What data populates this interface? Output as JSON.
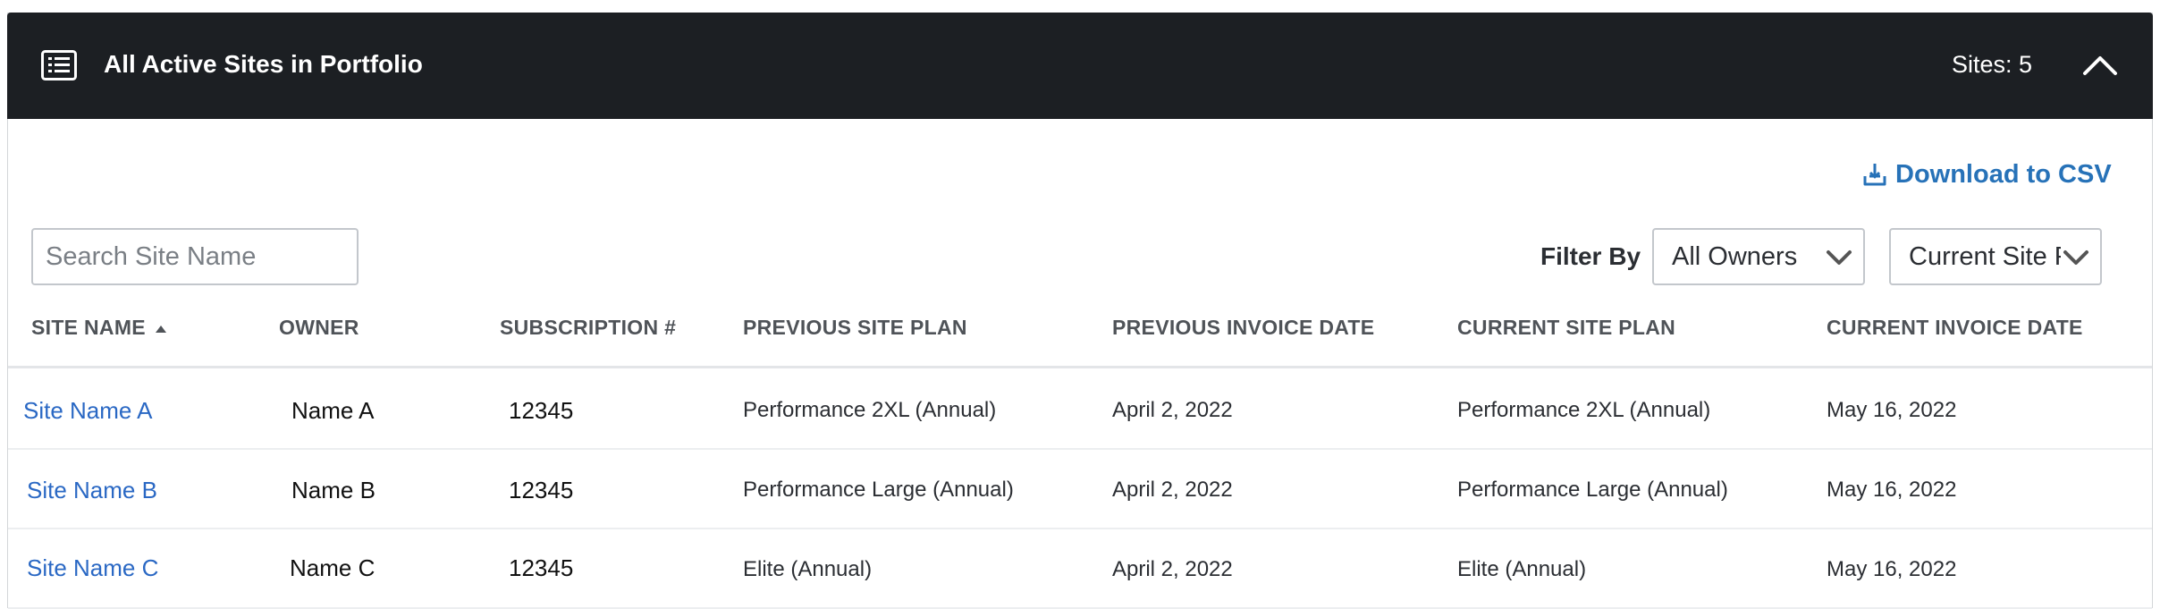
{
  "header": {
    "title": "All Active Sites in Portfolio",
    "sites_count": "Sites: 5",
    "icon": "list-icon",
    "background": "#1c1f23"
  },
  "toolbar": {
    "download_label": "Download to CSV",
    "search_placeholder": "Search Site Name",
    "filter_label": "Filter By",
    "owners_select": "All Owners",
    "plan_select": "Current Site P",
    "accent_color": "#2772b8"
  },
  "table": {
    "columns": [
      "SITE NAME",
      "OWNER",
      "SUBSCRIPTION #",
      "PREVIOUS SITE PLAN",
      "PREVIOUS INVOICE DATE",
      "CURRENT SITE PLAN",
      "CURRENT INVOICE DATE"
    ],
    "sorted_column": "SITE NAME",
    "sort_direction": "ascending",
    "rows": [
      {
        "site_name": "Site Name A",
        "owner": "Name A",
        "subscription": "12345",
        "previous_plan": "Performance 2XL (Annual)",
        "previous_invoice_date": "April 2, 2022",
        "current_plan": "Performance 2XL (Annual)",
        "current_invoice_date": "May 16, 2022"
      },
      {
        "site_name": "Site Name B",
        "owner": "Name B",
        "subscription": "12345",
        "previous_plan": "Performance Large (Annual)",
        "previous_invoice_date": "April 2, 2022",
        "current_plan": "Performance Large (Annual)",
        "current_invoice_date": "May 16, 2022"
      },
      {
        "site_name": "Site Name C",
        "owner": "Name C",
        "subscription": "12345",
        "previous_plan": "Elite (Annual)",
        "previous_invoice_date": "April 2, 2022",
        "current_plan": "Elite (Annual)",
        "current_invoice_date": "May 16, 2022"
      }
    ]
  }
}
